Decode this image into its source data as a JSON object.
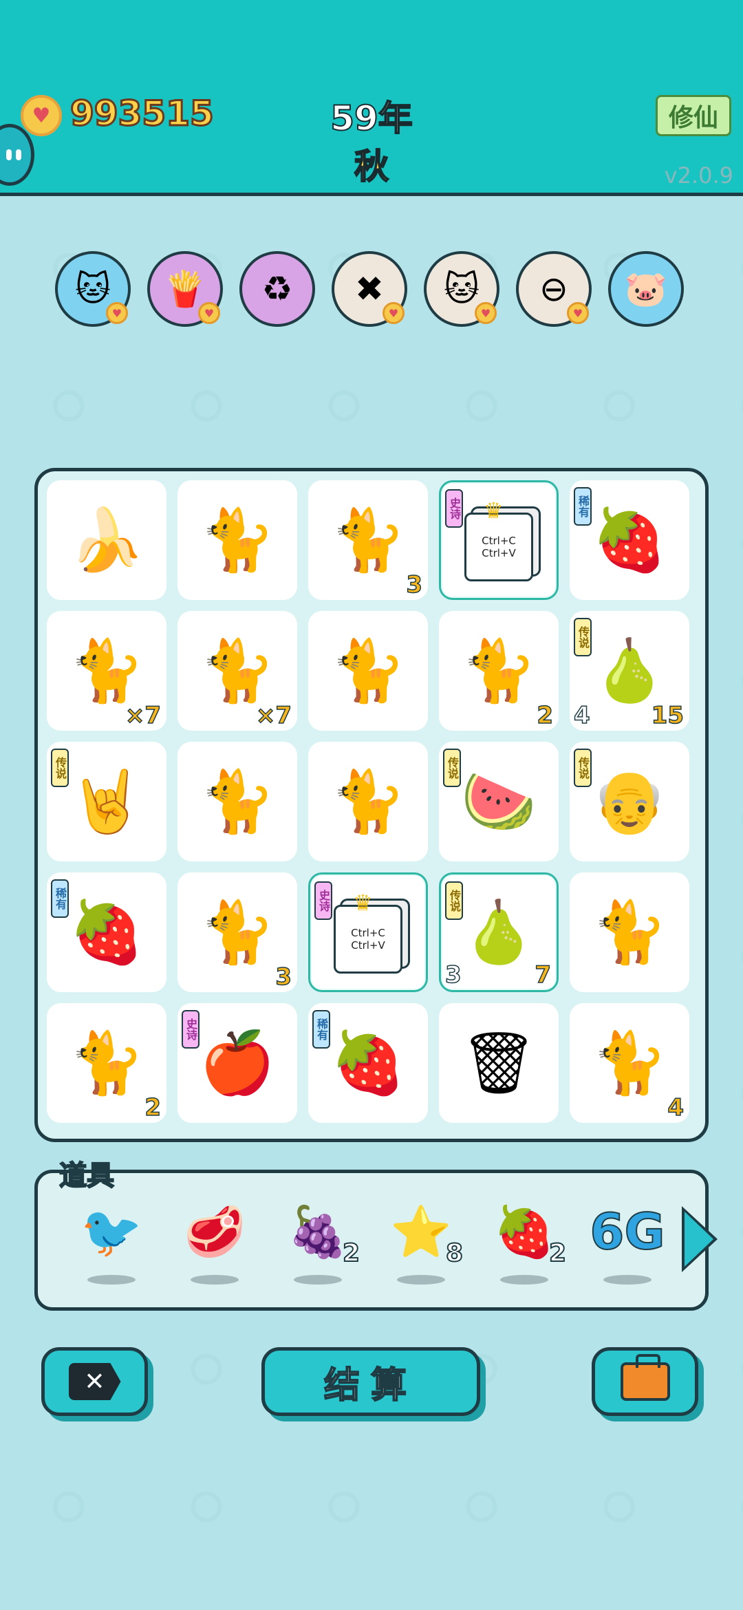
{
  "header": {
    "coin_count": "993515",
    "year": "59年",
    "season": "秋",
    "mode_button": "修仙",
    "version": "v2.0.9"
  },
  "powerups": [
    {
      "name": "cat-hole",
      "glyph": "🐱",
      "bg": "#7fd3f0"
    },
    {
      "name": "fries",
      "glyph": "🍟",
      "bg": "#d9a4e6"
    },
    {
      "name": "recycle",
      "glyph": "♻",
      "bg": "#d9a4e6"
    },
    {
      "name": "delete-tag",
      "glyph": "✖",
      "bg": "#efe6dc"
    },
    {
      "name": "cats-pair",
      "glyph": "🐱",
      "bg": "#efe6dc"
    },
    {
      "name": "minus",
      "glyph": "⊖",
      "bg": "#efe6dc"
    },
    {
      "name": "piggy-bank",
      "glyph": "🐷",
      "bg": "#7fd3f0"
    }
  ],
  "board": {
    "rank_labels": {
      "epic": "史诗",
      "legend": "传说",
      "rare": "稀有"
    },
    "cells": [
      {
        "item": "banana",
        "glyph": "🍌",
        "rank": "",
        "count_br": "",
        "count_bl": ""
      },
      {
        "item": "cat",
        "glyph": "🐈",
        "rank": "",
        "count_br": "",
        "count_bl": ""
      },
      {
        "item": "cat",
        "glyph": "🐈",
        "rank": "",
        "count_br": "3",
        "count_bl": ""
      },
      {
        "item": "ctrl-cv",
        "glyph": "",
        "rank": "epic",
        "count_br": "",
        "count_bl": "",
        "ctrl_top": "Ctrl+C",
        "ctrl_bottom": "Ctrl+V"
      },
      {
        "item": "lychee",
        "glyph": "🍓",
        "rank": "rare",
        "count_br": "",
        "count_bl": ""
      },
      {
        "item": "cat",
        "glyph": "🐈",
        "rank": "",
        "count_br": "×7",
        "count_bl": ""
      },
      {
        "item": "cat",
        "glyph": "🐈",
        "rank": "",
        "count_br": "×7",
        "count_bl": ""
      },
      {
        "item": "cat",
        "glyph": "🐈",
        "rank": "",
        "count_br": "",
        "count_bl": ""
      },
      {
        "item": "cat",
        "glyph": "🐈",
        "rank": "",
        "count_br": "2",
        "count_bl": ""
      },
      {
        "item": "crowned-pear",
        "glyph": "🍐",
        "rank": "legend",
        "count_br": "15",
        "count_bl": "4"
      },
      {
        "item": "rock-hand",
        "glyph": "🤘",
        "rank": "legend",
        "count_br": "",
        "count_bl": ""
      },
      {
        "item": "cat",
        "glyph": "🐈",
        "rank": "",
        "count_br": "",
        "count_bl": ""
      },
      {
        "item": "cat",
        "glyph": "🐈",
        "rank": "",
        "count_br": "",
        "count_bl": ""
      },
      {
        "item": "watermelon",
        "glyph": "🍉",
        "rank": "legend",
        "count_br": "",
        "count_bl": ""
      },
      {
        "item": "crowned-grandpa",
        "glyph": "👴",
        "rank": "legend",
        "count_br": "",
        "count_bl": ""
      },
      {
        "item": "lychee",
        "glyph": "🍓",
        "rank": "rare",
        "count_br": "",
        "count_bl": ""
      },
      {
        "item": "cat",
        "glyph": "🐈",
        "rank": "",
        "count_br": "3",
        "count_bl": ""
      },
      {
        "item": "ctrl-cv",
        "glyph": "",
        "rank": "epic",
        "count_br": "",
        "count_bl": "",
        "ctrl_top": "Ctrl+C",
        "ctrl_bottom": "Ctrl+V"
      },
      {
        "item": "pear",
        "glyph": "🍐",
        "rank": "legend",
        "count_br": "7",
        "count_bl": "3"
      },
      {
        "item": "cat",
        "glyph": "🐈",
        "rank": "",
        "count_br": "",
        "count_bl": ""
      },
      {
        "item": "cat",
        "glyph": "🐈",
        "rank": "",
        "count_br": "2",
        "count_bl": ""
      },
      {
        "item": "apple",
        "glyph": "🍎",
        "rank": "epic",
        "count_br": "",
        "count_bl": ""
      },
      {
        "item": "lychee",
        "glyph": "🍓",
        "rank": "rare",
        "count_br": "",
        "count_bl": ""
      },
      {
        "item": "trash-bag",
        "glyph": "🗑",
        "rank": "",
        "count_br": "",
        "count_bl": ""
      },
      {
        "item": "cat",
        "glyph": "🐈",
        "rank": "",
        "count_br": "4",
        "count_bl": ""
      }
    ]
  },
  "tools": {
    "label": "道具",
    "items": [
      {
        "name": "bird",
        "glyph": "🐦",
        "count": ""
      },
      {
        "name": "liver",
        "glyph": "🥩",
        "count": ""
      },
      {
        "name": "bayberry",
        "glyph": "🍇",
        "count": "2"
      },
      {
        "name": "star",
        "glyph": "⭐",
        "count": "8"
      },
      {
        "name": "strawberry",
        "glyph": "🍓",
        "count": "2"
      },
      {
        "name": "6g",
        "glyph": "6G",
        "count": ""
      }
    ]
  },
  "buttons": {
    "settle": "结算"
  }
}
